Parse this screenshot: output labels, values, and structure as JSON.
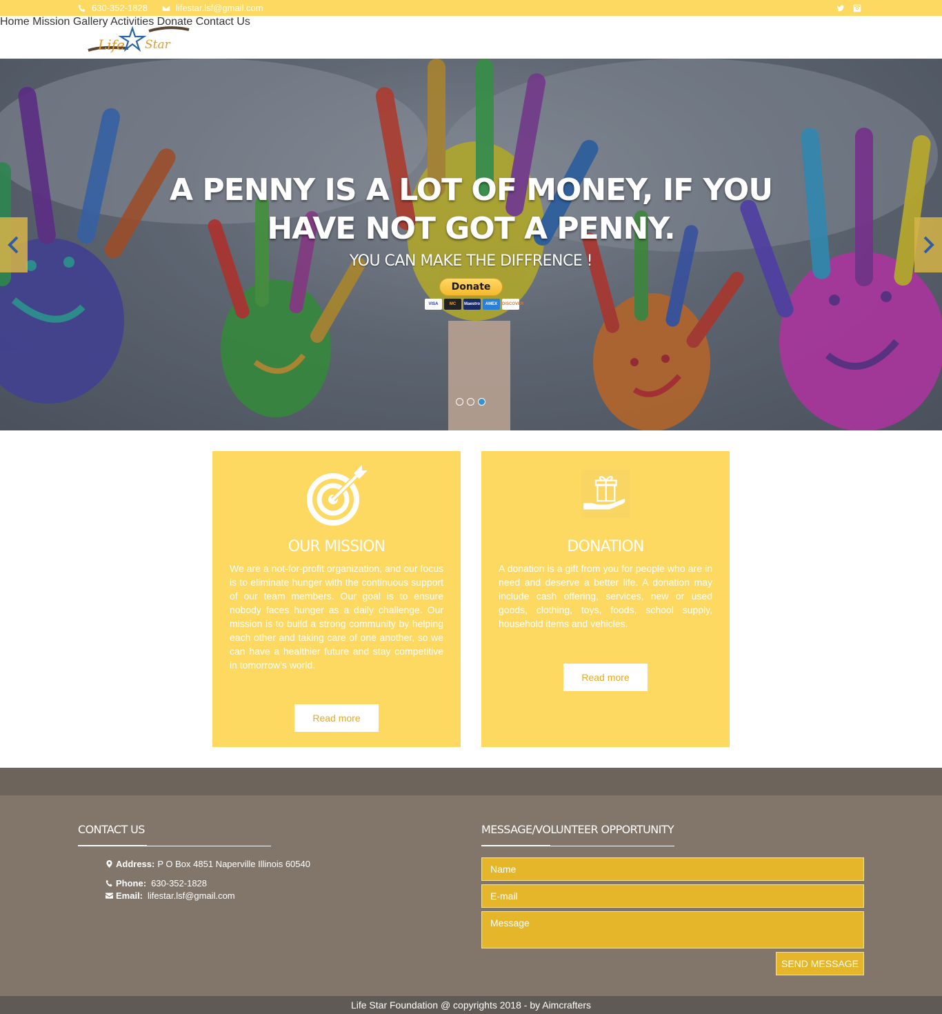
{
  "topbar": {
    "phone": "630-352-1828",
    "email": "lifestar.lsf@gmail.com",
    "social": [
      "twitter-icon",
      "instagram-icon"
    ]
  },
  "header": {
    "logo_text": "Life Star",
    "nav": [
      "Home",
      "Mission",
      "Gallery",
      "Activities",
      "Donate",
      "Contact Us"
    ]
  },
  "hero": {
    "headline": "A PENNY IS A LOT OF MONEY, IF YOU HAVE NOT GOT A PENNY.",
    "subheadline": "YOU CAN MAKE THE DIFFRENCE !",
    "donate_label": "Donate",
    "card_brands": [
      "VISA",
      "MC",
      "Maestro",
      "AMEX",
      "DISCOVER"
    ],
    "slides_total": 3,
    "active_slide": 3
  },
  "mission": {
    "title": "OUR MISSION",
    "text": "We are a not-for-profit organization, and our focus is to eliminate hunger with the continuous support of our team members. Our goal is to ensure nobody faces hunger as a daily challenge. Our mission is to build a strong community by helping each other and taking care of one another, so we can have a healthier future and stay competitive in tomorrow's world.",
    "button": "Read more"
  },
  "donation": {
    "title": "DONATION",
    "text": "A donation is a gift from you for people who are in need and deserve a better life. A donation may include cash offering, services, new or used goods, clothing, toys, foods, school supply, household items and vehicles.",
    "button": "Read more"
  },
  "footer": {
    "contact_title": "CONTACT US",
    "address_label": "Address:",
    "address": "P O Box 4851 Naperville Illinois 60540",
    "phone_label": "Phone:",
    "phone": "630-352-1828",
    "email_label": "Email:",
    "email": "lifestar.lsf@gmail.com",
    "form_title": "MESSAGE/VOLUNTEER OPPORTUNITY",
    "name_placeholder": "Name",
    "email_placeholder": "E-mail",
    "message_placeholder": "Message",
    "send_label": "SEND MESSAGE",
    "copyright": "Life Star Foundation @ copyrights 2018 - by Aimcrafters"
  },
  "colors": {
    "accent": "#fdd962",
    "nav_text": "#f0a94a",
    "footer_bg": "#82766b",
    "field_bg": "#e5b52a"
  }
}
